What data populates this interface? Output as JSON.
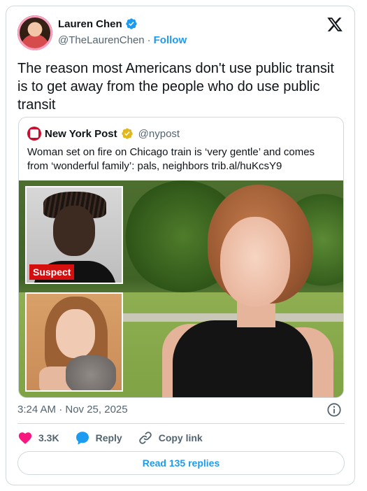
{
  "post": {
    "author": {
      "display_name": "Lauren Chen",
      "handle": "@TheLaurenChen",
      "separator": "·",
      "follow_label": "Follow",
      "verified": true
    },
    "text": "The reason most Americans don't use public transit is to get away from the people who do use public transit",
    "timestamp": "3:24 AM · Nov 25, 2025"
  },
  "quote": {
    "author": {
      "display_name": "New York Post",
      "handle": "@nypost",
      "verified": true
    },
    "text": "Woman set on fire on Chicago train is ‘very gentle’ and comes from ‘wonderful family’: pals, neighbors trib.al/huKcsY9",
    "media": {
      "badge": "Suspect"
    }
  },
  "actions": {
    "like_count": "3.3K",
    "reply_label": "Reply",
    "copy_label": "Copy link",
    "read_replies_label": "Read 135 replies"
  },
  "colors": {
    "accent": "#1d9bf0",
    "like": "#f91880",
    "muted": "#536471",
    "border": "#cfd9de",
    "badge": "#d50f0f",
    "verified_gold": "#e2b719"
  },
  "icons": {
    "platform": "x-logo-icon",
    "verified": "verified-badge-icon",
    "like": "heart-icon",
    "reply": "speech-bubble-icon",
    "copy": "link-icon",
    "info": "info-icon"
  }
}
